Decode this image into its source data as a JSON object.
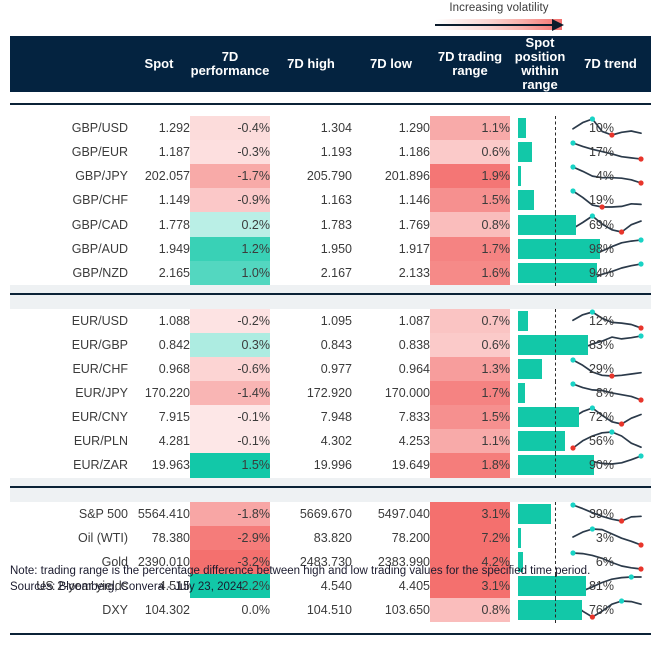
{
  "legend": {
    "label": "Increasing volatility",
    "gradient_from": "#ffffff",
    "gradient_to": "#f4706e",
    "arrow_color": "#0b1b2b"
  },
  "colors": {
    "header_bg": "#042340",
    "positive": "#12c8a8",
    "negative": "#f4706e",
    "bar": "#12c8a8",
    "spark_line": "#2b3a4a",
    "spark_max_dot": "#19d3c5",
    "spark_min_dot": "#e8352b"
  },
  "header": {
    "columns": [
      {
        "label": "",
        "name": "instrument"
      },
      {
        "label": "Spot",
        "name": "spot"
      },
      {
        "label": "7D performance",
        "name": "perf"
      },
      {
        "label": "7D high",
        "name": "high"
      },
      {
        "label": "7D low",
        "name": "low"
      },
      {
        "label": "7D trading range",
        "name": "range"
      },
      {
        "label": "Spot position within range",
        "name": "position"
      },
      {
        "label": "7D trend",
        "name": "trend"
      }
    ]
  },
  "sections": [
    {
      "name": "gbp-crosses",
      "rows": [
        {
          "instrument": "GBP/USD",
          "spot": "1.292",
          "perf": "-0.4%",
          "perf_val": -0.4,
          "high": "1.304",
          "low": "1.290",
          "range": "1.1%",
          "range_val": 1.1,
          "position": "10%",
          "position_val": 10,
          "spark": [
            52,
            38,
            30,
            58,
            66,
            60,
            57,
            62
          ]
        },
        {
          "instrument": "GBP/EUR",
          "spot": "1.187",
          "perf": "-0.3%",
          "perf_val": -0.3,
          "high": "1.193",
          "low": "1.186",
          "range": "0.6%",
          "range_val": 0.6,
          "position": "17%",
          "position_val": 17,
          "spark": [
            22,
            34,
            44,
            52,
            60,
            70,
            74,
            78
          ]
        },
        {
          "instrument": "GBP/JPY",
          "spot": "202.057",
          "perf": "-1.7%",
          "perf_val": -1.7,
          "high": "205.790",
          "low": "201.896",
          "range": "1.9%",
          "range_val": 1.9,
          "position": "4%",
          "position_val": 4,
          "spark": [
            18,
            34,
            52,
            58,
            58,
            60,
            66,
            78
          ]
        },
        {
          "instrument": "GBP/CHF",
          "spot": "1.149",
          "perf": "-0.9%",
          "perf_val": -0.9,
          "high": "1.163",
          "low": "1.146",
          "range": "1.5%",
          "range_val": 1.5,
          "position": "19%",
          "position_val": 19,
          "spark": [
            18,
            38,
            62,
            68,
            68,
            66,
            58,
            60
          ]
        },
        {
          "instrument": "GBP/CAD",
          "spot": "1.778",
          "perf": "0.2%",
          "perf_val": 0.2,
          "high": "1.783",
          "low": "1.769",
          "range": "0.8%",
          "range_val": 0.8,
          "position": "69%",
          "position_val": 69,
          "spark": [
            60,
            44,
            26,
            48,
            64,
            70,
            50,
            40
          ]
        },
        {
          "instrument": "GBP/AUD",
          "spot": "1.949",
          "perf": "1.2%",
          "perf_val": 1.2,
          "high": "1.950",
          "low": "1.917",
          "range": "1.7%",
          "range_val": 1.7,
          "position": "98%",
          "position_val": 98,
          "spark": [
            74,
            62,
            58,
            56,
            40,
            26,
            20,
            16
          ]
        },
        {
          "instrument": "GBP/NZD",
          "spot": "2.165",
          "perf": "1.0%",
          "perf_val": 1.0,
          "high": "2.167",
          "low": "2.133",
          "range": "1.6%",
          "range_val": 1.6,
          "position": "94%",
          "position_val": 94,
          "spark": [
            72,
            76,
            70,
            56,
            46,
            34,
            26,
            20
          ]
        }
      ]
    },
    {
      "name": "eur-crosses",
      "rows": [
        {
          "instrument": "EUR/USD",
          "spot": "1.088",
          "perf": "-0.2%",
          "perf_val": -0.2,
          "high": "1.095",
          "low": "1.087",
          "range": "0.7%",
          "range_val": 0.7,
          "position": "12%",
          "position_val": 12,
          "spark": [
            50,
            34,
            26,
            44,
            56,
            58,
            62,
            72
          ]
        },
        {
          "instrument": "EUR/GBP",
          "spot": "0.842",
          "perf": "0.3%",
          "perf_val": 0.3,
          "high": "0.843",
          "low": "0.838",
          "range": "0.6%",
          "range_val": 0.6,
          "position": "83%",
          "position_val": 83,
          "spark": [
            76,
            62,
            48,
            38,
            24,
            30,
            26,
            20
          ]
        },
        {
          "instrument": "EUR/CHF",
          "spot": "0.968",
          "perf": "-0.6%",
          "perf_val": -0.6,
          "high": "0.977",
          "low": "0.964",
          "range": "1.3%",
          "range_val": 1.3,
          "position": "29%",
          "position_val": 29,
          "spark": [
            20,
            36,
            56,
            66,
            68,
            66,
            62,
            58
          ]
        },
        {
          "instrument": "EUR/JPY",
          "spot": "170.220",
          "perf": "-1.4%",
          "perf_val": -1.4,
          "high": "172.920",
          "low": "170.000",
          "range": "1.7%",
          "range_val": 1.7,
          "position": "8%",
          "position_val": 8,
          "spark": [
            20,
            32,
            40,
            42,
            50,
            56,
            62,
            74
          ]
        },
        {
          "instrument": "EUR/CNY",
          "spot": "7.915",
          "perf": "-0.1%",
          "perf_val": -0.1,
          "high": "7.948",
          "low": "7.833",
          "range": "1.5%",
          "range_val": 1.5,
          "position": "72%",
          "position_val": 72,
          "spark": [
            52,
            36,
            26,
            46,
            64,
            70,
            54,
            44
          ]
        },
        {
          "instrument": "EUR/PLN",
          "spot": "4.281",
          "perf": "-0.1%",
          "perf_val": -0.1,
          "high": "4.302",
          "low": "4.253",
          "range": "1.1%",
          "range_val": 1.1,
          "position": "56%",
          "position_val": 56,
          "spark": [
            64,
            46,
            34,
            26,
            24,
            34,
            52,
            62
          ]
        },
        {
          "instrument": "EUR/ZAR",
          "spot": "19.963",
          "perf": "1.5%",
          "perf_val": 1.5,
          "high": "19.996",
          "low": "19.649",
          "range": "1.8%",
          "range_val": 1.8,
          "position": "90%",
          "position_val": 90,
          "spark": [
            74,
            52,
            40,
            46,
            48,
            44,
            34,
            22
          ]
        }
      ]
    },
    {
      "name": "indices-commodities",
      "rows": [
        {
          "instrument": "S&P 500",
          "spot": "5564.410",
          "perf": "-1.8%",
          "perf_val": -1.8,
          "high": "5669.670",
          "low": "5497.040",
          "range": "3.1%",
          "range_val": 3.1,
          "position": "39%",
          "position_val": 39,
          "spark": [
            18,
            30,
            44,
            56,
            66,
            72,
            58,
            56
          ]
        },
        {
          "instrument": "Oil (WTI)",
          "spot": "78.380",
          "perf": "-2.9%",
          "perf_val": -2.9,
          "high": "83.820",
          "low": "78.200",
          "range": "7.2%",
          "range_val": 7.2,
          "position": "3%",
          "position_val": 3,
          "spark": [
            48,
            32,
            22,
            24,
            38,
            52,
            62,
            74
          ]
        },
        {
          "instrument": "Gold",
          "spot": "2390.010",
          "perf": "-3.2%",
          "perf_val": -3.2,
          "high": "2483.730",
          "low": "2383.990",
          "range": "4.2%",
          "range_val": 4.2,
          "position": "6%",
          "position_val": 6,
          "spark": [
            20,
            22,
            28,
            38,
            52,
            64,
            70,
            74
          ]
        },
        {
          "instrument": "US 2-year yields",
          "spot": "4.515",
          "perf": "2.2%",
          "perf_val": 2.2,
          "high": "4.540",
          "low": "4.405",
          "range": "3.1%",
          "range_val": 3.1,
          "position": "81%",
          "position_val": 81,
          "spark": [
            74,
            66,
            52,
            36,
            24,
            18,
            16,
            16
          ]
        },
        {
          "instrument": "DXY",
          "spot": "104.302",
          "perf": "0.0%",
          "perf_val": 0.0,
          "high": "104.510",
          "low": "103.650",
          "range": "0.8%",
          "range_val": 0.8,
          "position": "76%",
          "position_val": 76,
          "spark": [
            30,
            56,
            74,
            56,
            34,
            24,
            26,
            34
          ]
        }
      ]
    }
  ],
  "footer": {
    "note": "Note: trading range is the percentage difference between high and low trading values for the specified time period.",
    "sources": "Sources: Bloomberg, Convera - July 23, 2024"
  }
}
